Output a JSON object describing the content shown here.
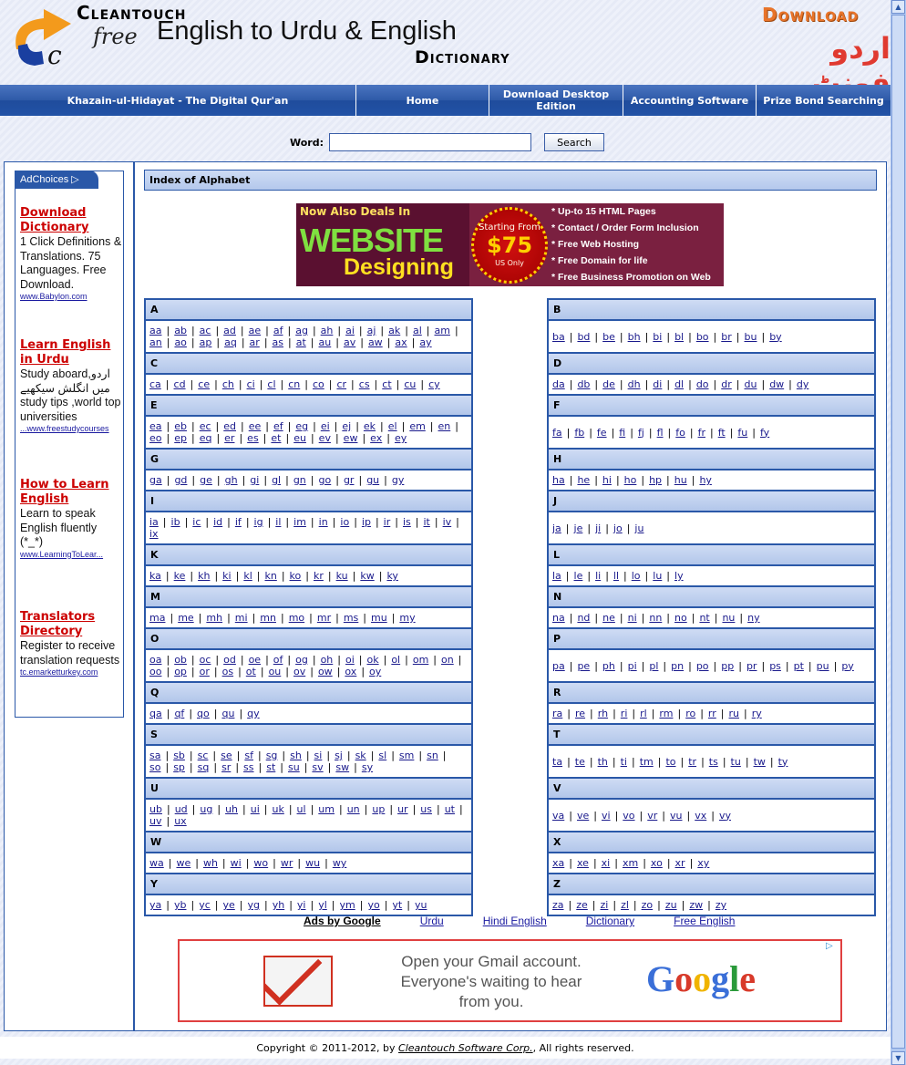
{
  "header": {
    "brand": "Cleantouch",
    "free": "free",
    "tagline": "English to Urdu & English",
    "dictionary": "Dictionary",
    "download": "Download",
    "urdu_font": "اردو فونٹ"
  },
  "nav": [
    {
      "label": "Khazain-ul-Hidayat - The Digital Qur'an"
    },
    {
      "label": "Home"
    },
    {
      "label": "Download Desktop Edition"
    },
    {
      "label": "Accounting Software"
    },
    {
      "label": "Prize Bond Searching"
    }
  ],
  "search": {
    "label": "Word:",
    "value": "",
    "button": "Search"
  },
  "sidebar": {
    "adchoices": "AdChoices",
    "ads": [
      {
        "title": "Download Dictionary",
        "desc": "1 Click Definitions & Translations. 75 Languages. Free Download.",
        "url": "www.Babylon.com"
      },
      {
        "title": "Learn English in Urdu",
        "desc": "Study aboard,اردو میں انگلش سیکھیے study tips ,world top universities",
        "url": "...www.freestudycourses"
      },
      {
        "title": "How to Learn English",
        "desc": "Learn to speak English fluently (*_*)",
        "url": "www.LearningToLear..."
      },
      {
        "title": "Translators Directory",
        "desc": "Register to receive translation requests",
        "url": "tc.emarketturkey.com"
      }
    ]
  },
  "main": {
    "index_title": "Index of Alphabet",
    "banner": {
      "now": "Now Also Deals In",
      "website": "WEBSITE",
      "designing": "Designing",
      "starting": "Starting From",
      "price": "$75",
      "us": "US Only",
      "features": [
        "* Up-to 15 HTML Pages",
        "* Contact / Order Form Inclusion",
        "* Free Web Hosting",
        "* Free Domain for life",
        "* Free Business Promotion on Web"
      ]
    },
    "letters": [
      {
        "letter": "A",
        "words": [
          "aa",
          "ab",
          "ac",
          "ad",
          "ae",
          "af",
          "ag",
          "ah",
          "ai",
          "aj",
          "ak",
          "al",
          "am",
          "an",
          "ao",
          "ap",
          "aq",
          "ar",
          "as",
          "at",
          "au",
          "av",
          "aw",
          "ax",
          "ay"
        ]
      },
      {
        "letter": "B",
        "words": [
          "ba",
          "bd",
          "be",
          "bh",
          "bi",
          "bl",
          "bo",
          "br",
          "bu",
          "by"
        ]
      },
      {
        "letter": "C",
        "words": [
          "ca",
          "cd",
          "ce",
          "ch",
          "ci",
          "cl",
          "cn",
          "co",
          "cr",
          "cs",
          "ct",
          "cu",
          "cy"
        ]
      },
      {
        "letter": "D",
        "words": [
          "da",
          "db",
          "de",
          "dh",
          "di",
          "dl",
          "do",
          "dr",
          "du",
          "dw",
          "dy"
        ]
      },
      {
        "letter": "E",
        "words": [
          "ea",
          "eb",
          "ec",
          "ed",
          "ee",
          "ef",
          "eg",
          "ei",
          "ej",
          "ek",
          "el",
          "em",
          "en",
          "eo",
          "ep",
          "eq",
          "er",
          "es",
          "et",
          "eu",
          "ev",
          "ew",
          "ex",
          "ey"
        ]
      },
      {
        "letter": "F",
        "words": [
          "fa",
          "fb",
          "fe",
          "fi",
          "fj",
          "fl",
          "fo",
          "fr",
          "ft",
          "fu",
          "fy"
        ]
      },
      {
        "letter": "G",
        "words": [
          "ga",
          "gd",
          "ge",
          "gh",
          "gi",
          "gl",
          "gn",
          "go",
          "gr",
          "gu",
          "gy"
        ]
      },
      {
        "letter": "H",
        "words": [
          "ha",
          "he",
          "hi",
          "ho",
          "hp",
          "hu",
          "hy"
        ]
      },
      {
        "letter": "I",
        "words": [
          "ia",
          "ib",
          "ic",
          "id",
          "if",
          "ig",
          "il",
          "im",
          "in",
          "io",
          "ip",
          "ir",
          "is",
          "it",
          "iv",
          "ix"
        ]
      },
      {
        "letter": "J",
        "words": [
          "ja",
          "je",
          "ji",
          "jo",
          "ju"
        ]
      },
      {
        "letter": "K",
        "words": [
          "ka",
          "ke",
          "kh",
          "ki",
          "kl",
          "kn",
          "ko",
          "kr",
          "ku",
          "kw",
          "ky"
        ]
      },
      {
        "letter": "L",
        "words": [
          "la",
          "le",
          "li",
          "ll",
          "lo",
          "lu",
          "ly"
        ]
      },
      {
        "letter": "M",
        "words": [
          "ma",
          "me",
          "mh",
          "mi",
          "mn",
          "mo",
          "mr",
          "ms",
          "mu",
          "my"
        ]
      },
      {
        "letter": "N",
        "words": [
          "na",
          "nd",
          "ne",
          "ni",
          "nn",
          "no",
          "nt",
          "nu",
          "ny"
        ]
      },
      {
        "letter": "O",
        "words": [
          "oa",
          "ob",
          "oc",
          "od",
          "oe",
          "of",
          "og",
          "oh",
          "oi",
          "ok",
          "ol",
          "om",
          "on",
          "oo",
          "op",
          "or",
          "os",
          "ot",
          "ou",
          "ov",
          "ow",
          "ox",
          "oy"
        ]
      },
      {
        "letter": "P",
        "words": [
          "pa",
          "pe",
          "ph",
          "pi",
          "pl",
          "pn",
          "po",
          "pp",
          "pr",
          "ps",
          "pt",
          "pu",
          "py"
        ]
      },
      {
        "letter": "Q",
        "words": [
          "qa",
          "qf",
          "qo",
          "qu",
          "qy"
        ]
      },
      {
        "letter": "R",
        "words": [
          "ra",
          "re",
          "rh",
          "ri",
          "rl",
          "rm",
          "ro",
          "rr",
          "ru",
          "ry"
        ]
      },
      {
        "letter": "S",
        "words": [
          "sa",
          "sb",
          "sc",
          "se",
          "sf",
          "sg",
          "sh",
          "si",
          "sj",
          "sk",
          "sl",
          "sm",
          "sn",
          "so",
          "sp",
          "sq",
          "sr",
          "ss",
          "st",
          "su",
          "sv",
          "sw",
          "sy"
        ]
      },
      {
        "letter": "T",
        "words": [
          "ta",
          "te",
          "th",
          "ti",
          "tm",
          "to",
          "tr",
          "ts",
          "tu",
          "tw",
          "ty"
        ]
      },
      {
        "letter": "U",
        "words": [
          "ub",
          "ud",
          "ug",
          "uh",
          "ui",
          "uk",
          "ul",
          "um",
          "un",
          "up",
          "ur",
          "us",
          "ut",
          "uv",
          "ux"
        ]
      },
      {
        "letter": "V",
        "words": [
          "va",
          "ve",
          "vi",
          "vo",
          "vr",
          "vu",
          "vx",
          "vy"
        ]
      },
      {
        "letter": "W",
        "words": [
          "wa",
          "we",
          "wh",
          "wi",
          "wo",
          "wr",
          "wu",
          "wy"
        ]
      },
      {
        "letter": "X",
        "words": [
          "xa",
          "xe",
          "xi",
          "xm",
          "xo",
          "xr",
          "xy"
        ]
      },
      {
        "letter": "Y",
        "words": [
          "ya",
          "yb",
          "yc",
          "ye",
          "yg",
          "yh",
          "yi",
          "yl",
          "ym",
          "yo",
          "yt",
          "yu"
        ]
      },
      {
        "letter": "Z",
        "words": [
          "za",
          "ze",
          "zi",
          "zl",
          "zo",
          "zu",
          "zw",
          "zy"
        ]
      }
    ],
    "ads_by_google": "Ads by Google",
    "ad_links": [
      "Urdu",
      "Hindi English",
      "Dictionary",
      "Free English"
    ],
    "gmail_ad": {
      "text": "Open your Gmail account. Everyone's waiting to hear from you.",
      "brand": "Google"
    }
  },
  "footer": {
    "prefix": "Copyright © 2011-2012, by ",
    "company": "Cleantouch Software Corp.",
    "suffix": ", All rights reserved."
  }
}
